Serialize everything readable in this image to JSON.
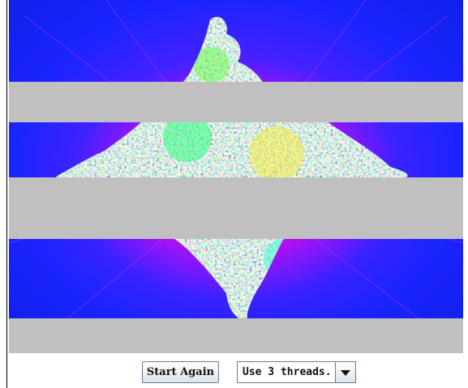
{
  "canvas": {
    "image": "mandelbrot-fractal"
  },
  "controls": {
    "start_again_label": "Start Again",
    "threads_selected": "Use 3 threads."
  },
  "colors": {
    "band_gray": "#c0c0c0",
    "background_blue": "#1a24ff"
  }
}
